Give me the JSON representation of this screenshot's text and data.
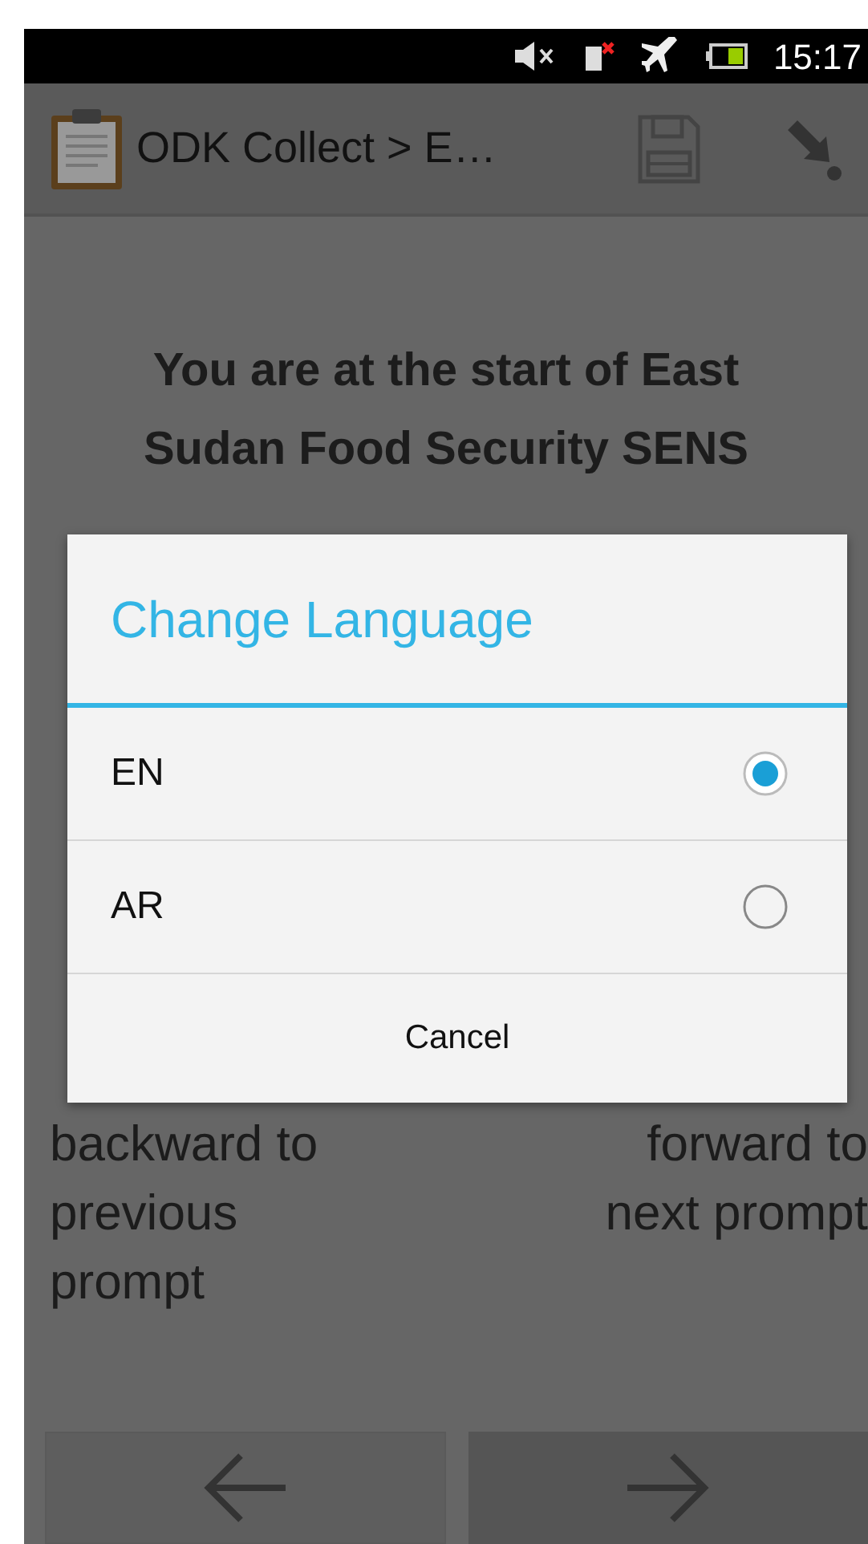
{
  "status_bar": {
    "time": "15:17"
  },
  "action_bar": {
    "title": "ODK Collect > E…"
  },
  "prompt": {
    "heading": "You are at the start of East Sudan Food Security SENS",
    "left_hint": "backward to previous prompt",
    "right_hint": "forward to next prompt"
  },
  "dialog": {
    "title": "Change Language",
    "options": [
      {
        "label": "EN",
        "selected": true
      },
      {
        "label": "AR",
        "selected": false
      }
    ],
    "cancel": "Cancel"
  }
}
